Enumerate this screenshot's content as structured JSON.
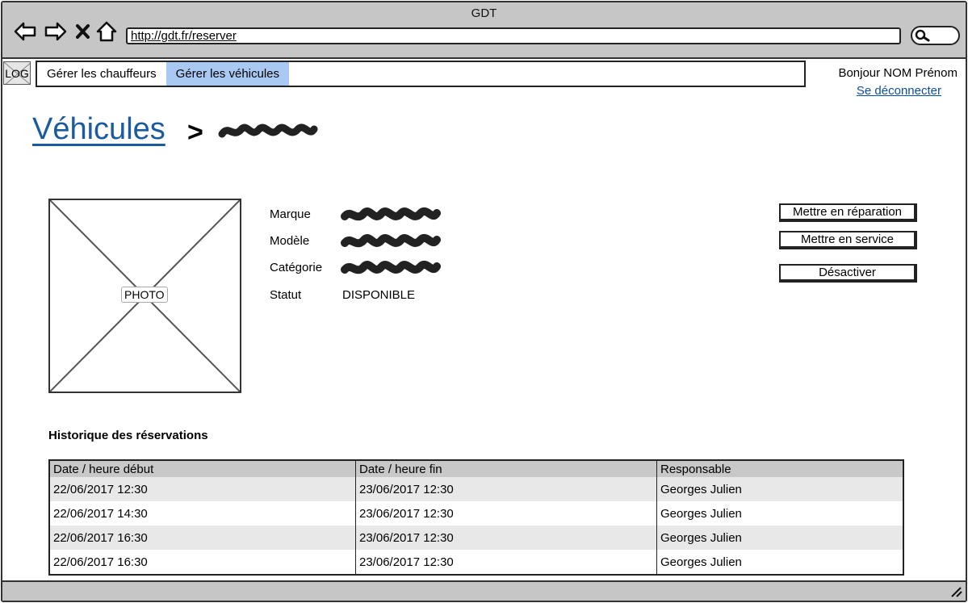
{
  "window": {
    "title": "GDT",
    "url": "http://gdt.fr/reserver"
  },
  "header": {
    "logo": "LOG",
    "nav": [
      {
        "label": "Gérer les chauffeurs",
        "active": false
      },
      {
        "label": "Gérer les véhicules",
        "active": true
      }
    ],
    "greeting": "Bonjour NOM Prénom",
    "logout": "Se déconnecter"
  },
  "breadcrumb": {
    "parent": "Véhicules",
    "separator": ">"
  },
  "vehicle": {
    "photo_label": "PHOTO",
    "fields": [
      {
        "label": "Marque"
      },
      {
        "label": "Modèle"
      },
      {
        "label": "Catégorie"
      },
      {
        "label": "Statut",
        "value": "DISPONIBLE"
      }
    ]
  },
  "actions": {
    "repair": "Mettre en réparation",
    "service": "Mettre en service",
    "deactivate": "Désactiver"
  },
  "history": {
    "title": "Historique des réservations",
    "columns": [
      "Date / heure début",
      "Date / heure fin",
      "Responsable"
    ],
    "rows": [
      [
        "22/06/2017 12:30",
        "23/06/2017 12:30",
        "Georges Julien"
      ],
      [
        "22/06/2017 14:30",
        "23/06/2017 12:30",
        "Georges Julien"
      ],
      [
        "22/06/2017 16:30",
        "23/06/2017 12:30",
        "Georges Julien"
      ],
      [
        "22/06/2017 16:30",
        "23/06/2017 12:30",
        "Georges Julien"
      ]
    ]
  },
  "colors": {
    "chrome": "#c6c6c6",
    "active_tab": "#a9c9f3",
    "link": "#1a5a9e",
    "table_header": "#c8c8c8",
    "row_alt": "#e8e8e8"
  }
}
